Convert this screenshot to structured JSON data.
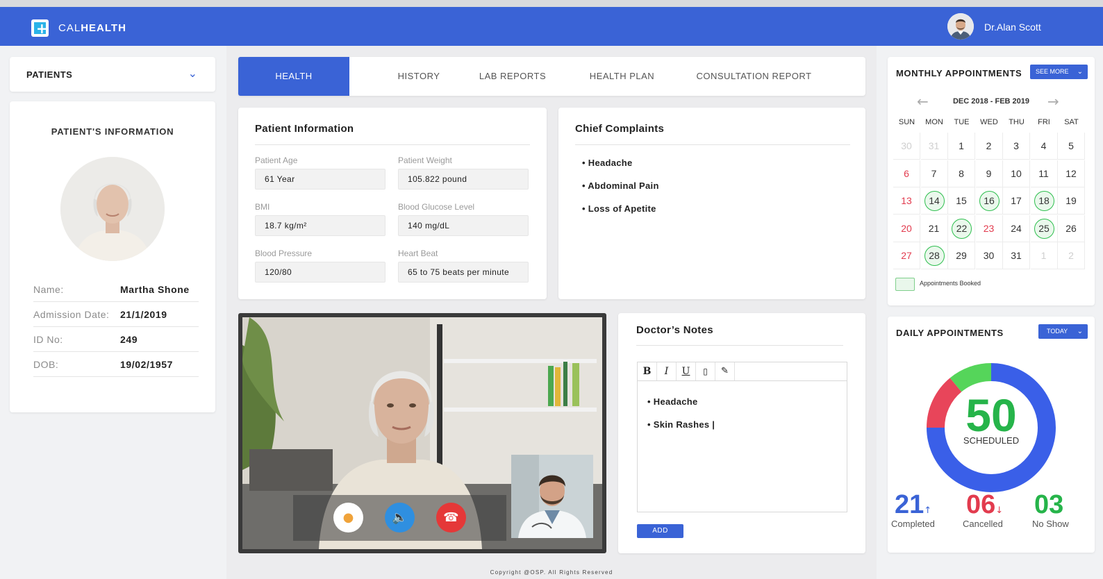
{
  "header": {
    "brand_light": "CAL",
    "brand_bold": "HEALTH",
    "doctor_name": "Dr.Alan Scott"
  },
  "patients_dropdown": {
    "label": "PATIENTS"
  },
  "patient_card": {
    "title": "PATIENT'S INFORMATION",
    "rows": [
      {
        "key": "Name:",
        "value": "Martha Shone"
      },
      {
        "key": "Admission Date:",
        "value": "21/1/2019"
      },
      {
        "key": "ID No:",
        "value": "249"
      },
      {
        "key": "DOB:",
        "value": "19/02/1957"
      }
    ]
  },
  "tabs": [
    {
      "label": "HEALTH",
      "active": true
    },
    {
      "label": "HISTORY"
    },
    {
      "label": "LAB REPORTS"
    },
    {
      "label": "HEALTH PLAN"
    },
    {
      "label": "CONSULTATION REPORT"
    }
  ],
  "patient_information": {
    "title": "Patient Information",
    "fields": [
      {
        "label": "Patient Age",
        "value": "61 Year"
      },
      {
        "label": "Patient Weight",
        "value": "105.822 pound"
      },
      {
        "label": "BMI",
        "value": "18.7 kg/m²"
      },
      {
        "label": "Blood Glucose Level",
        "value": "140 mg/dL"
      },
      {
        "label": "Blood Pressure",
        "value": "120/80"
      },
      {
        "label": "Heart Beat",
        "value": "65  to 75  beats per minute"
      }
    ]
  },
  "chief_complaints": {
    "title": "Chief Complaints",
    "items": [
      "• Headache",
      "• Abdominal Pain",
      "• Loss of Apetite"
    ]
  },
  "video_call": {
    "controls": [
      {
        "name": "mute-button",
        "icon": "mic-icon",
        "color": "#ffffff"
      },
      {
        "name": "speaker-button",
        "icon": "speaker-icon",
        "color": "#2f8fe0"
      },
      {
        "name": "end-call-button",
        "icon": "hangup-icon",
        "color": "#e53838"
      }
    ]
  },
  "doctor_notes": {
    "title": "Doctor’s Notes",
    "toolbar": {
      "bold": "B",
      "italic": "I",
      "underline": "U"
    },
    "lines": [
      "• Headache",
      "• Skin Rashes |"
    ],
    "add_label": "ADD"
  },
  "footer": {
    "copyright": "Copyright @OSP. All Rights Reserved"
  },
  "monthly": {
    "title": "MONTHLY APPOINTMENTS",
    "see_more": "SEE MORE",
    "range": "DEC 2018 - FEB 2019",
    "days": [
      "SUN",
      "MON",
      "TUE",
      "WED",
      "THU",
      "FRI",
      "SAT"
    ],
    "weeks": [
      [
        "30",
        "31",
        "1",
        "2",
        "3",
        "4",
        "5"
      ],
      [
        "6",
        "7",
        "8",
        "9",
        "10",
        "11",
        "12"
      ],
      [
        "13",
        "14",
        "15",
        "16",
        "17",
        "18",
        "19"
      ],
      [
        "20",
        "21",
        "22",
        "23",
        "24",
        "25",
        "26"
      ],
      [
        "27",
        "28",
        "29",
        "30",
        "31",
        "1",
        "2"
      ]
    ],
    "booked": [
      "14",
      "16",
      "18",
      "22",
      "25",
      "28"
    ],
    "legend": "Appointments Booked"
  },
  "daily": {
    "title": "DAILY APPOINTMENTS",
    "filter": "TODAY",
    "total": "50",
    "total_label": "SCHEDULED",
    "completed": "21",
    "completed_label": "Completed",
    "cancelled": "06",
    "cancelled_label": "Cancelled",
    "no_show": "03",
    "no_show_label": "No Show",
    "colors": {
      "completed": "#3a63d6",
      "cancelled": "#e23b4e",
      "no_show": "#26b44a"
    },
    "donut": [
      {
        "name": "scheduled",
        "share": 0.75,
        "color": "#3a5fe8"
      },
      {
        "name": "cancelled",
        "share": 0.14,
        "color": "#e8455a"
      },
      {
        "name": "no-show",
        "share": 0.11,
        "color": "#55d55a"
      }
    ]
  }
}
